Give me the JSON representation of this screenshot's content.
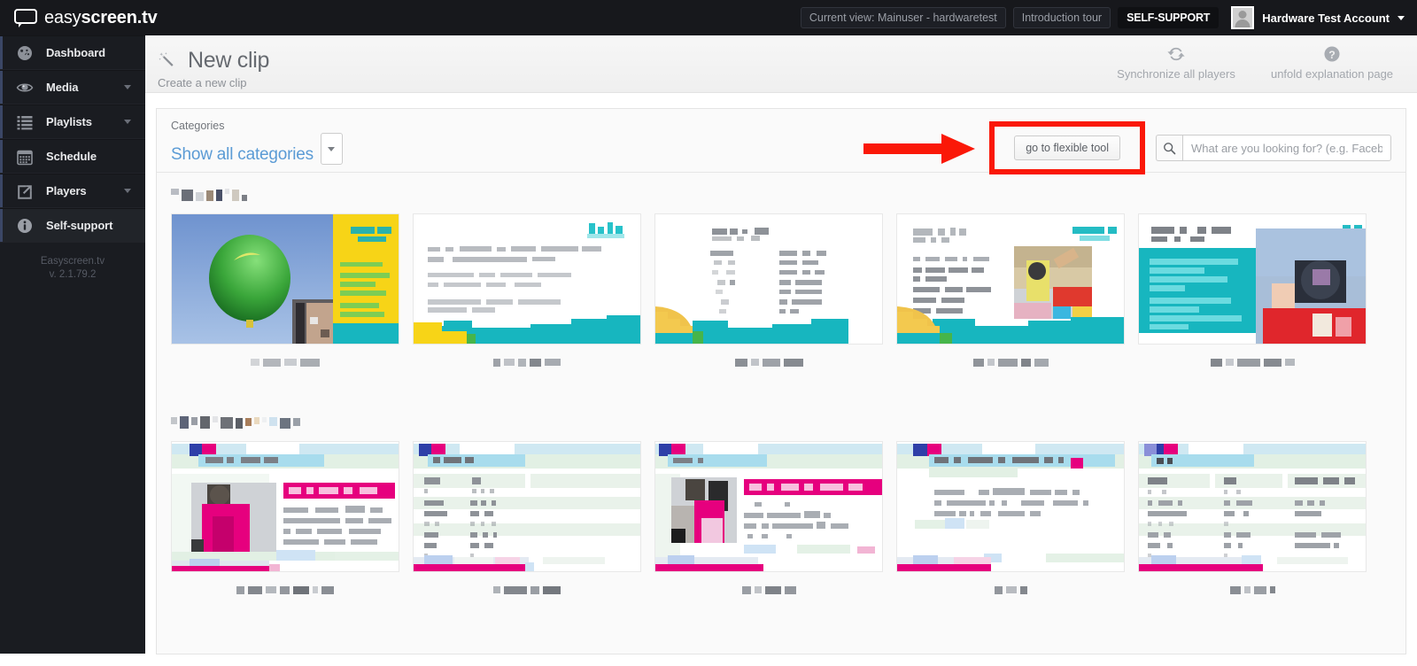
{
  "brand": {
    "light": "easy",
    "bold": "screen",
    "tld": ".tv"
  },
  "topbar": {
    "current_view": "Current view: Mainuser - hardwaretest",
    "intro_tour": "Introduction tour",
    "self_support": "SELF-SUPPORT",
    "account_name": "Hardware Test Account"
  },
  "sidebar": {
    "items": [
      {
        "label": "Dashboard",
        "icon": "gauge-icon",
        "caret": false,
        "active": false
      },
      {
        "label": "Media",
        "icon": "eye-icon",
        "caret": true,
        "active": false
      },
      {
        "label": "Playlists",
        "icon": "list-icon",
        "caret": true,
        "active": false
      },
      {
        "label": "Schedule",
        "icon": "calendar-icon",
        "caret": false,
        "active": false
      },
      {
        "label": "Players",
        "icon": "external-link-icon",
        "caret": true,
        "active": false
      },
      {
        "label": "Self-support",
        "icon": "info-icon",
        "caret": false,
        "active": true
      }
    ],
    "footer_name": "Easyscreen.tv",
    "footer_version": "v. 2.1.79.2"
  },
  "page_header": {
    "title": "New clip",
    "subtitle": "Create a new clip",
    "icon": "magic-wand-icon",
    "actions": [
      {
        "label": "Synchronize all players",
        "icon": "sync-icon"
      },
      {
        "label": "unfold explanation page",
        "icon": "question-circle-icon"
      }
    ]
  },
  "toolbar": {
    "categories_label": "Categories",
    "categories_value": "Show all categories",
    "flexible_tool_label": "go to flexible tool",
    "search_placeholder": "What are you looking for? (e.g. Facebook)",
    "search_value": "",
    "highlight_color": "#fa1808",
    "accent_color": "#5b9bd5"
  },
  "annotation": {
    "type": "arrow",
    "color": "#fa1808",
    "points_to": "go to flexible tool"
  },
  "sections": [
    {
      "name": "section-1",
      "title_redacted": true,
      "cards": [
        {
          "name": "template-card-1",
          "label_redacted": true
        },
        {
          "name": "template-card-2",
          "label_redacted": true
        },
        {
          "name": "template-card-3",
          "label_redacted": true
        },
        {
          "name": "template-card-4",
          "label_redacted": true
        },
        {
          "name": "template-card-5",
          "label_redacted": true
        }
      ]
    },
    {
      "name": "section-2",
      "title_redacted": true,
      "cards": [
        {
          "name": "template-card-6",
          "label_redacted": true
        },
        {
          "name": "template-card-7",
          "label_redacted": true
        },
        {
          "name": "template-card-8",
          "label_redacted": true
        },
        {
          "name": "template-card-9",
          "label_redacted": true
        },
        {
          "name": "template-card-10",
          "label_redacted": true
        }
      ]
    }
  ]
}
